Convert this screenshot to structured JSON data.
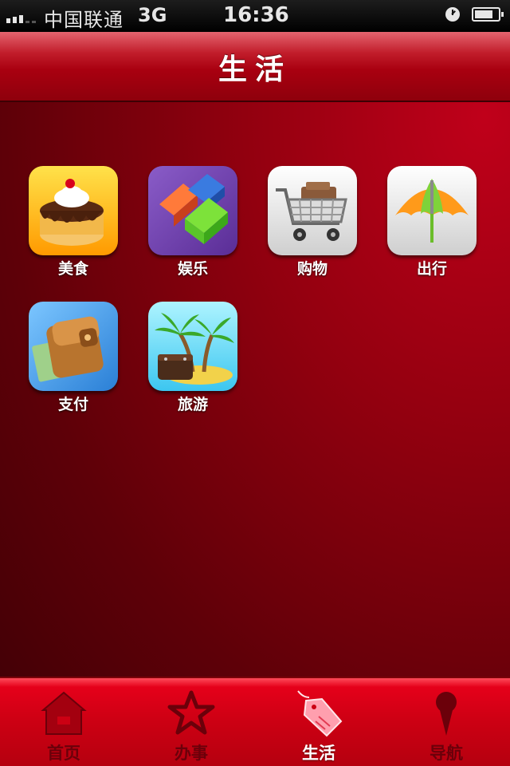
{
  "status_bar": {
    "carrier": "中国联通",
    "network": "3G",
    "time": "16:36",
    "icons": [
      "signal-icon",
      "clock-icon",
      "battery-icon"
    ]
  },
  "header": {
    "title": "生活"
  },
  "apps": [
    {
      "label": "美食",
      "icon": "cake-icon"
    },
    {
      "label": "娱乐",
      "icon": "blocks-icon"
    },
    {
      "label": "购物",
      "icon": "shopping-cart-icon"
    },
    {
      "label": "出行",
      "icon": "umbrella-icon"
    },
    {
      "label": "支付",
      "icon": "wallet-icon"
    },
    {
      "label": "旅游",
      "icon": "palm-island-icon"
    }
  ],
  "tab_bar": {
    "tabs": [
      {
        "label": "首页",
        "icon": "home-icon",
        "active": false
      },
      {
        "label": "办事",
        "icon": "star-icon",
        "active": false
      },
      {
        "label": "生活",
        "icon": "tag-icon",
        "active": true
      },
      {
        "label": "导航",
        "icon": "map-pin-icon",
        "active": false
      }
    ]
  },
  "colors": {
    "background": "#92000f",
    "title_bar": "#a90010",
    "tab_bar": "#cc0013",
    "tab_inactive_label": "#6b000a",
    "tab_active_label": "#ffffff"
  }
}
